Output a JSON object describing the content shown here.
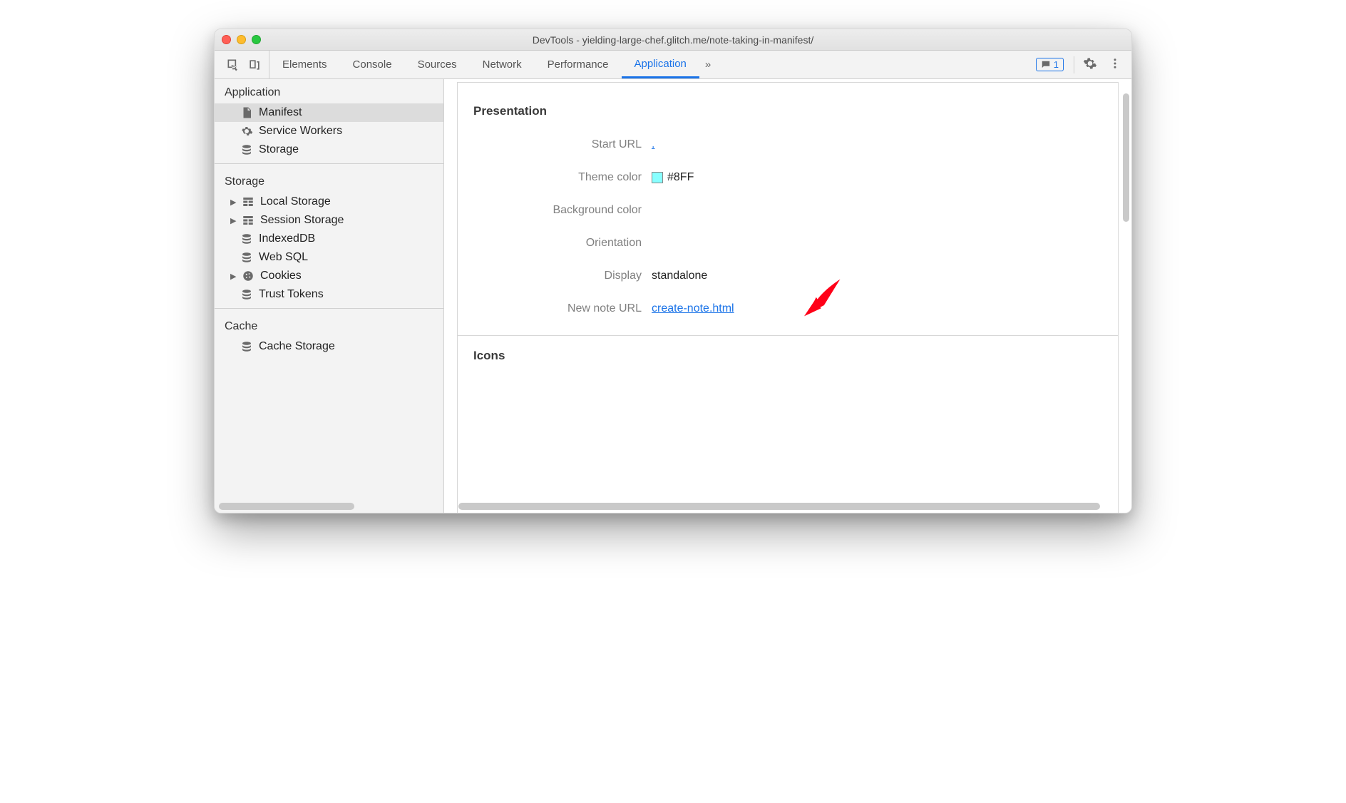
{
  "window": {
    "title": "DevTools - yielding-large-chef.glitch.me/note-taking-in-manifest/"
  },
  "toolbar": {
    "tabs": [
      "Elements",
      "Console",
      "Sources",
      "Network",
      "Performance",
      "Application"
    ],
    "active_tab": "Application",
    "badge_count": "1"
  },
  "sidebar": {
    "sections": {
      "application": {
        "title": "Application",
        "items": [
          "Manifest",
          "Service Workers",
          "Storage"
        ],
        "selected": "Manifest"
      },
      "storage": {
        "title": "Storage",
        "items": [
          "Local Storage",
          "Session Storage",
          "IndexedDB",
          "Web SQL",
          "Cookies",
          "Trust Tokens"
        ]
      },
      "cache": {
        "title": "Cache",
        "items": [
          "Cache Storage"
        ]
      }
    }
  },
  "panel": {
    "section1_title": "Presentation",
    "rows": {
      "start_url": {
        "label": "Start URL",
        "value": "."
      },
      "theme_color": {
        "label": "Theme color",
        "value": "#8FF",
        "swatch": "#88ffff"
      },
      "background_color": {
        "label": "Background color",
        "value": ""
      },
      "orientation": {
        "label": "Orientation",
        "value": ""
      },
      "display": {
        "label": "Display",
        "value": "standalone"
      },
      "new_note_url": {
        "label": "New note URL",
        "value": "create-note.html"
      }
    },
    "section2_title": "Icons"
  }
}
